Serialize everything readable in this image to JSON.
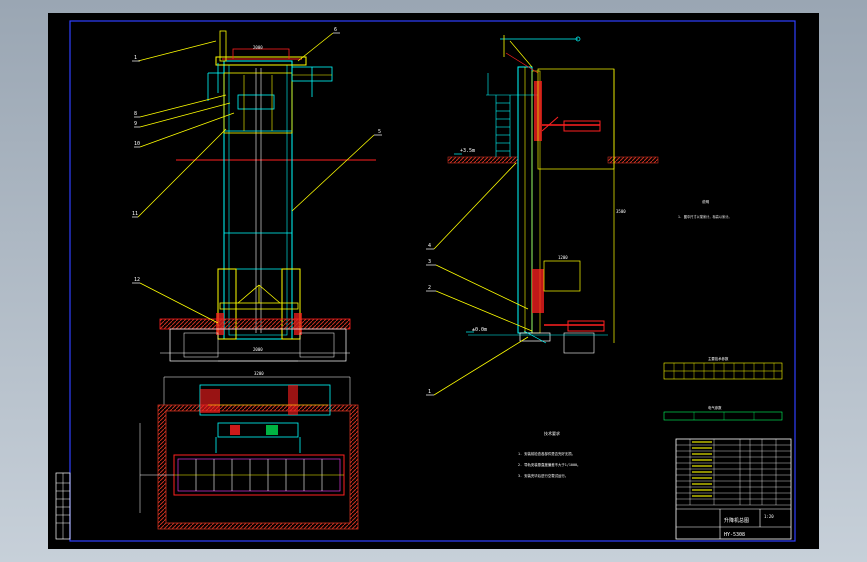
{
  "drawing": {
    "left_view_labels": [
      "1",
      "6",
      "8",
      "9",
      "10",
      "11",
      "12",
      "5"
    ],
    "side_view_labels": [
      "4",
      "3",
      "2",
      "1"
    ],
    "elevation_top": "+3.5m",
    "elevation_bottom": "±0.0m",
    "dim_top": "2000",
    "dim_bottom": "2000",
    "dim_plan": "3200",
    "dim_side_height": "3500",
    "dim_side_small": "1200",
    "notes_heading": "技术要求",
    "notes_lines": [
      "1. 安装前检查各部件是否完好无损。",
      "2. 导轨安装垂直度偏差不大于1/1000。",
      "3. 安装完毕后进行空载试运行。"
    ],
    "right_note_heading": "说明",
    "right_note_line": "1. 图中尺寸以毫米计，标高以米计。",
    "table1_title": "主要技术参数",
    "table2_title": "电气参数",
    "title_block_main": "升降机总图",
    "title_block_code": "HY-5308",
    "title_block_scale": "1:20"
  },
  "colors": {
    "cyan": "#00ffff",
    "yellow": "#ffff00",
    "red": "#ff2020",
    "white": "#ffffff",
    "blue": "#3040ff",
    "green": "#00ff60",
    "magenta": "#ff40ff",
    "hatch_red": "#c83020"
  }
}
